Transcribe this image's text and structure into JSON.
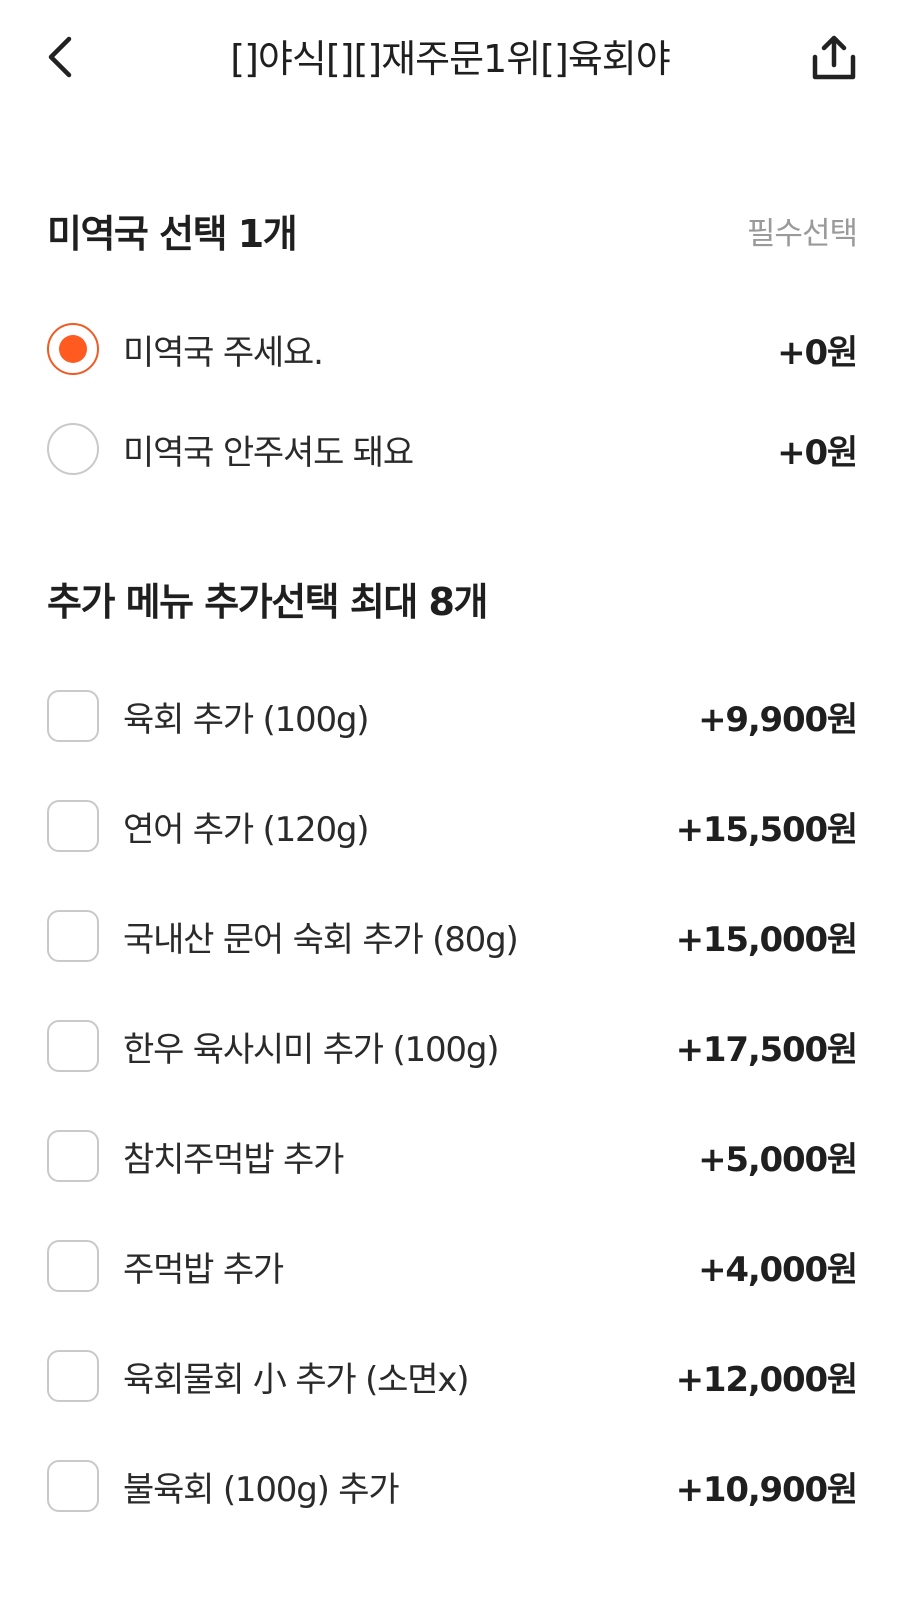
{
  "header": {
    "title": "[]야식[][]재주문1위[]육회야",
    "back_icon": "chevron-left-icon",
    "share_icon": "share-icon"
  },
  "sections": [
    {
      "title": "미역국 선택 1개",
      "badge": "필수선택",
      "type": "radio",
      "options": [
        {
          "label": "미역국 주세요.",
          "price": "+0원",
          "selected": true
        },
        {
          "label": "미역국 안주셔도 돼요",
          "price": "+0원",
          "selected": false
        }
      ]
    },
    {
      "title": "추가 메뉴 추가선택 최대 8개",
      "badge": "",
      "type": "checkbox",
      "options": [
        {
          "label": "육회 추가 (100g)",
          "price": "+9,900원",
          "selected": false
        },
        {
          "label": "연어 추가 (120g)",
          "price": "+15,500원",
          "selected": false
        },
        {
          "label": "국내산 문어 숙회 추가 (80g)",
          "price": "+15,000원",
          "selected": false
        },
        {
          "label": "한우 육사시미 추가 (100g)",
          "price": "+17,500원",
          "selected": false
        },
        {
          "label": "참치주먹밥 추가",
          "price": "+5,000원",
          "selected": false
        },
        {
          "label": "주먹밥 추가",
          "price": "+4,000원",
          "selected": false
        },
        {
          "label": "육회물회 小 추가 (소면x)",
          "price": "+12,000원",
          "selected": false
        },
        {
          "label": "불육회 (100g) 추가",
          "price": "+10,900원",
          "selected": false
        }
      ]
    }
  ],
  "colors": {
    "accent": "#ff5a1f",
    "border": "#c9c9c9",
    "muted": "#9a9a9a",
    "text": "#1f1f1f"
  }
}
